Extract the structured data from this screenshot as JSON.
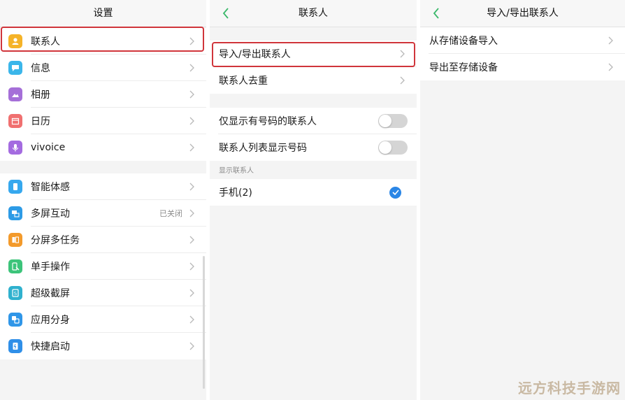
{
  "panel1": {
    "title": "设置",
    "group1": [
      {
        "label": "联系人",
        "icon": "contacts-icon",
        "color": "#f5b328"
      },
      {
        "label": "信息",
        "icon": "message-icon",
        "color": "#3bb6ea"
      },
      {
        "label": "相册",
        "icon": "album-icon",
        "color": "#a56fd8"
      },
      {
        "label": "日历",
        "icon": "calendar-icon",
        "color": "#f07070"
      },
      {
        "label": "vivoice",
        "icon": "microphone-icon",
        "color": "#a46be0"
      }
    ],
    "group2": [
      {
        "label": "智能体感",
        "icon": "motion-icon",
        "color": "#36a8ee"
      },
      {
        "label": "多屏互动",
        "icon": "multiscreen-icon",
        "color": "#2d9be6",
        "status": "已关闭"
      },
      {
        "label": "分屏多任务",
        "icon": "split-screen-icon",
        "color": "#f39a2b"
      },
      {
        "label": "单手操作",
        "icon": "one-hand-icon",
        "color": "#3cc47a"
      },
      {
        "label": "超级截屏",
        "icon": "screenshot-icon",
        "color": "#2fb1ce"
      },
      {
        "label": "应用分身",
        "icon": "app-clone-icon",
        "color": "#2f96e8"
      },
      {
        "label": "快捷启动",
        "icon": "quick-launch-icon",
        "color": "#2f8fe8"
      }
    ]
  },
  "panel2": {
    "title": "联系人",
    "import_export": "导入/导出联系人",
    "dedupe": "联系人去重",
    "toggle1": "仅显示有号码的联系人",
    "toggle2": "联系人列表显示号码",
    "section": "显示联系人",
    "phone": "手机(2)"
  },
  "panel3": {
    "title": "导入/导出联系人",
    "import": "从存储设备导入",
    "export": "导出至存储设备"
  },
  "watermark": "远方科技手游网",
  "colors": {
    "highlight": "#d0353b",
    "back_arrow": "#3ab86a",
    "check": "#2a86e6"
  }
}
